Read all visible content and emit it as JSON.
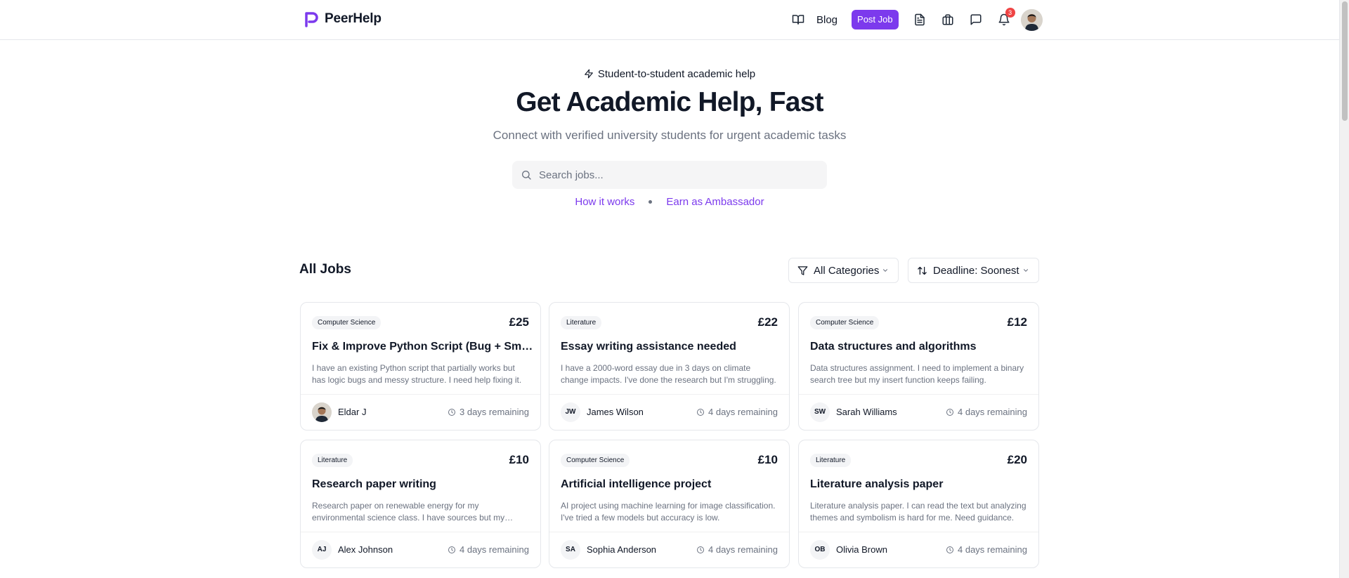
{
  "brand": {
    "name": "PeerHelp"
  },
  "nav": {
    "blog_label": "Blog",
    "post_job_label": "Post Job",
    "notification_count": "3"
  },
  "hero": {
    "tagline": "Student-to-student academic help",
    "title": "Get Academic Help, Fast",
    "subtitle": "Connect with verified university students for urgent academic tasks",
    "search_placeholder": "Search jobs...",
    "link_how": "How it works",
    "link_ambassador": "Earn as Ambassador"
  },
  "jobs": {
    "section_title": "All Jobs",
    "category_filter": "All Categories",
    "sort_filter": "Deadline: Soonest",
    "cards": [
      {
        "category": "Computer Science",
        "price": "£25",
        "title": "Fix & Improve Python Script (Bug + Small Refactor)",
        "description": "I have an existing Python script that partially works but has logic bugs and messy structure. I need help fixing it.",
        "author": "Eldar J",
        "initials": "",
        "remaining": "3 days remaining"
      },
      {
        "category": "Literature",
        "price": "£22",
        "title": "Essay writing assistance needed",
        "description": "I have a 2000-word essay due in 3 days on climate change impacts. I've done the research but I'm struggling.",
        "author": "James Wilson",
        "initials": "JW",
        "remaining": "4 days remaining"
      },
      {
        "category": "Computer Science",
        "price": "£12",
        "title": "Data structures and algorithms",
        "description": "Data structures assignment. I need to implement a binary search tree but my insert function keeps failing.",
        "author": "Sarah Williams",
        "initials": "SW",
        "remaining": "4 days remaining"
      },
      {
        "category": "Literature",
        "price": "£10",
        "title": "Research paper writing",
        "description": "Research paper on renewable energy for my environmental science class. I have sources but my structure is weak.",
        "author": "Alex Johnson",
        "initials": "AJ",
        "remaining": "4 days remaining"
      },
      {
        "category": "Computer Science",
        "price": "£10",
        "title": "Artificial intelligence project",
        "description": "AI project using machine learning for image classification. I've tried a few models but accuracy is low.",
        "author": "Sophia Anderson",
        "initials": "SA",
        "remaining": "4 days remaining"
      },
      {
        "category": "Literature",
        "price": "£20",
        "title": "Literature analysis paper",
        "description": "Literature analysis paper. I can read the text but analyzing themes and symbolism is hard for me. Need guidance.",
        "author": "Olivia Brown",
        "initials": "OB",
        "remaining": "4 days remaining"
      }
    ]
  },
  "colors": {
    "accent": "#7c3aed",
    "badge": "#ef4444",
    "muted": "#6b7280",
    "border": "#e5e7eb"
  },
  "icons": [
    "book-icon",
    "document-icon",
    "briefcase-icon",
    "message-icon",
    "bell-icon",
    "bolt-icon",
    "search-icon",
    "filter-icon",
    "sort-icon",
    "chevron-down-icon",
    "clock-icon"
  ]
}
